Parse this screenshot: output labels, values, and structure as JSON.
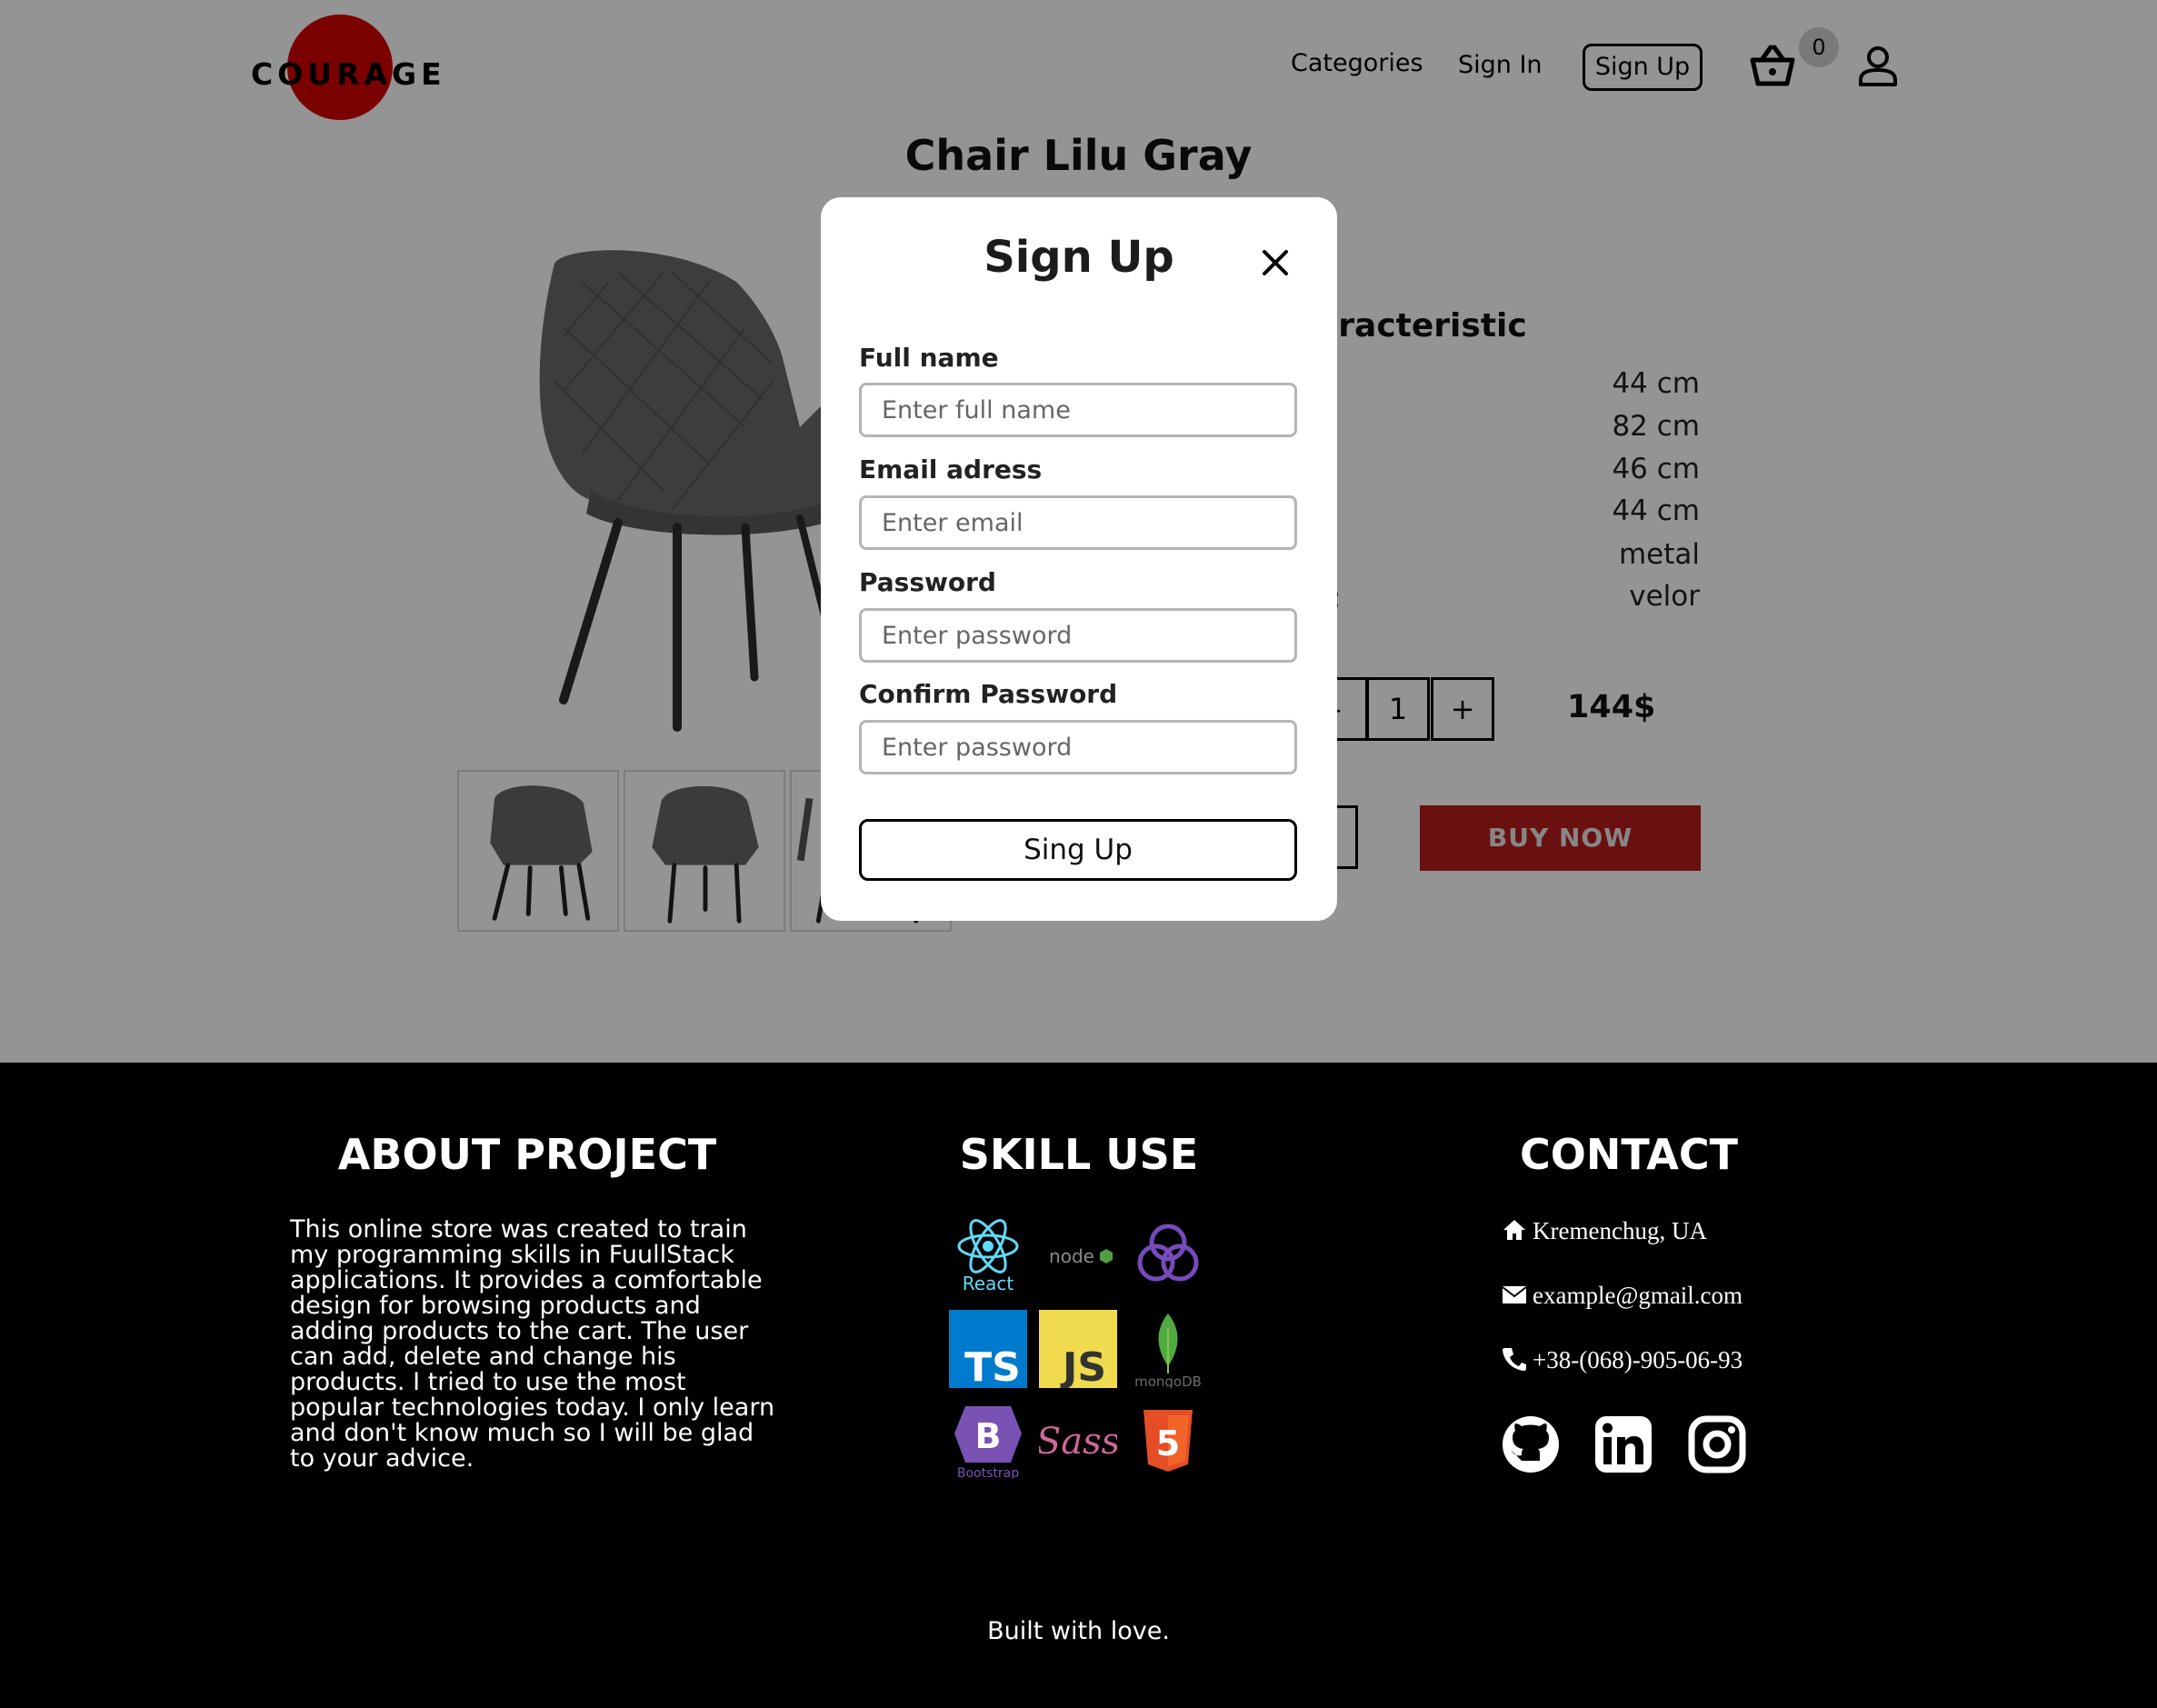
{
  "header": {
    "logo_text": "COURAGE",
    "nav": {
      "categories": "Categories",
      "sign_in": "Sign In",
      "sign_up": "Sign Up"
    },
    "cart_count": "0",
    "cart_icon": "basket-icon",
    "user_icon": "user-icon"
  },
  "product": {
    "title": "Chair Lilu Gray",
    "characteristics_title": "aracteristic",
    "characteristics_values": [
      "44 cm",
      "82 cm",
      "46 cm",
      "44 cm",
      "metal",
      "velor"
    ],
    "colon_fragment": ":",
    "qty_minus": "-",
    "qty_value": "1",
    "qty_plus": "+",
    "price": "144$",
    "buy_now": "BUY NOW"
  },
  "modal": {
    "title": "Sign Up",
    "close_icon": "close-icon",
    "full_name": {
      "label": "Full name",
      "placeholder": "Enter full name",
      "value": ""
    },
    "email": {
      "label": "Email adress",
      "placeholder": "Enter email",
      "value": ""
    },
    "password": {
      "label": "Password",
      "placeholder": "Enter password",
      "value": ""
    },
    "confirm_password": {
      "label": "Confirm Password",
      "placeholder": "Enter password",
      "value": ""
    },
    "submit": "Sing Up"
  },
  "footer": {
    "about": {
      "heading": "ABOUT PROJECT",
      "text": "This online store was created to train my programming skills in FuullStack applications. It provides a comfortable design for browsing products and adding products to the cart. The user can add, delete and change his products. I tried to use the most popular technologies today. I only learn and don't know much so I will be glad to your advice."
    },
    "skills": {
      "heading": "SKILL USE",
      "react_label": "React",
      "node_label": "node",
      "ts_label": "TS",
      "js_label": "JS",
      "mongo_label": "mongoDB",
      "bootstrap_label": "Bootstrap",
      "bootstrap_letter": "B",
      "sass_label": "Sass",
      "html_label": "5"
    },
    "contact": {
      "heading": "CONTACT",
      "address": "Kremenchug, UA",
      "email": "example@gmail.com",
      "phone": "+38-(068)-905-06-93"
    },
    "built": "Built with love."
  },
  "colors": {
    "brand_red": "#d40000",
    "buy_button": "#b81c1c",
    "overlay": "rgba(0,0,0,0.42)",
    "footer_bg": "#000000"
  }
}
